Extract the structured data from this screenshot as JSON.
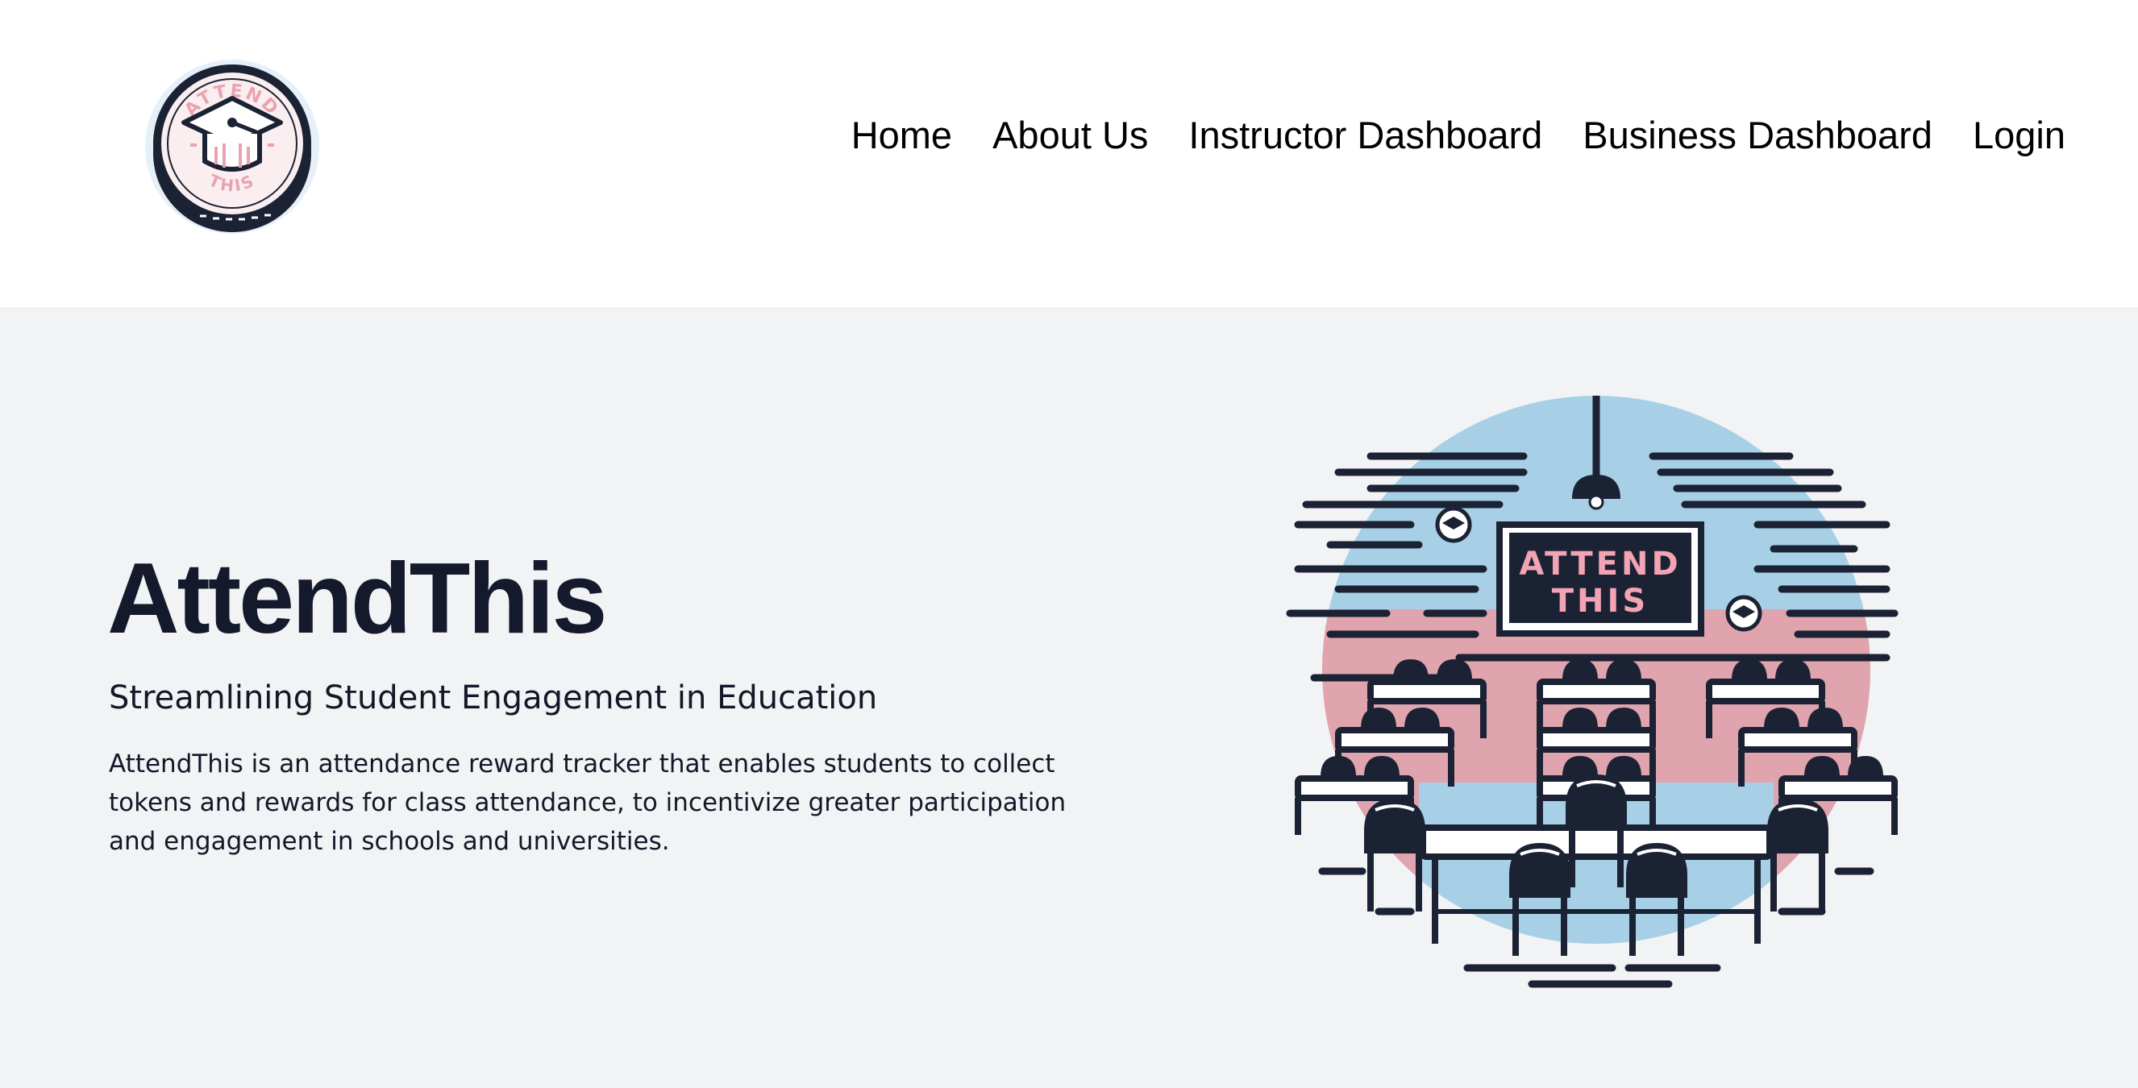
{
  "header": {
    "logo": {
      "top_text": "ATTEND",
      "bottom_text": "THIS",
      "icon": "graduation-cap-icon"
    },
    "nav": [
      {
        "label": "Home"
      },
      {
        "label": "About Us"
      },
      {
        "label": "Instructor Dashboard"
      },
      {
        "label": "Business Dashboard"
      },
      {
        "label": "Login"
      }
    ]
  },
  "hero": {
    "title": "AttendThis",
    "subtitle": "Streamlining Student Engagement in Education",
    "description": "AttendThis is an attendance reward tracker that enables students to collect tokens and rewards for class attendance, to incentivize greater participation and engagement in schools and universities.",
    "illustration": {
      "board_line1": "ATTEND",
      "board_line2": "THIS"
    }
  },
  "colors": {
    "navy": "#1b2233",
    "pink": "#e9a3b0",
    "blue": "#a7d0e6",
    "hero_bg": "#f2f3f5"
  }
}
